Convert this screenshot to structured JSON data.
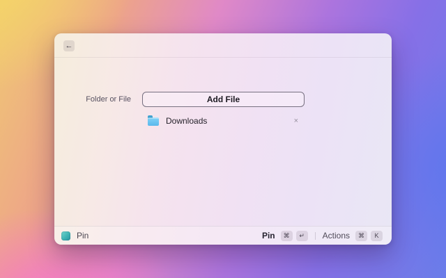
{
  "window": {
    "header": {
      "back_icon": "←"
    },
    "form": {
      "field_label": "Folder or File",
      "add_button_label": "Add File",
      "items": [
        {
          "icon": "folder",
          "name": "Downloads",
          "remove_icon": "×"
        }
      ]
    },
    "footer": {
      "app_name": "Pin",
      "primary_action": {
        "label": "Pin",
        "keys": [
          "⌘",
          "↵"
        ]
      },
      "secondary_action": {
        "label": "Actions",
        "keys": [
          "⌘",
          "K"
        ]
      }
    }
  },
  "colors": {
    "folder_blue": "#5ab8ec",
    "folder_tab_blue": "#41a2cf",
    "app_icon_teal": "#3fb4b4",
    "window_tint_left": "#f5eddc",
    "window_tint_right": "#e9e7f5",
    "bg_gradient": [
      "#f5d667",
      "#eda489",
      "#e089c7",
      "#ab74de",
      "#6b7de9",
      "#f674cd"
    ]
  }
}
